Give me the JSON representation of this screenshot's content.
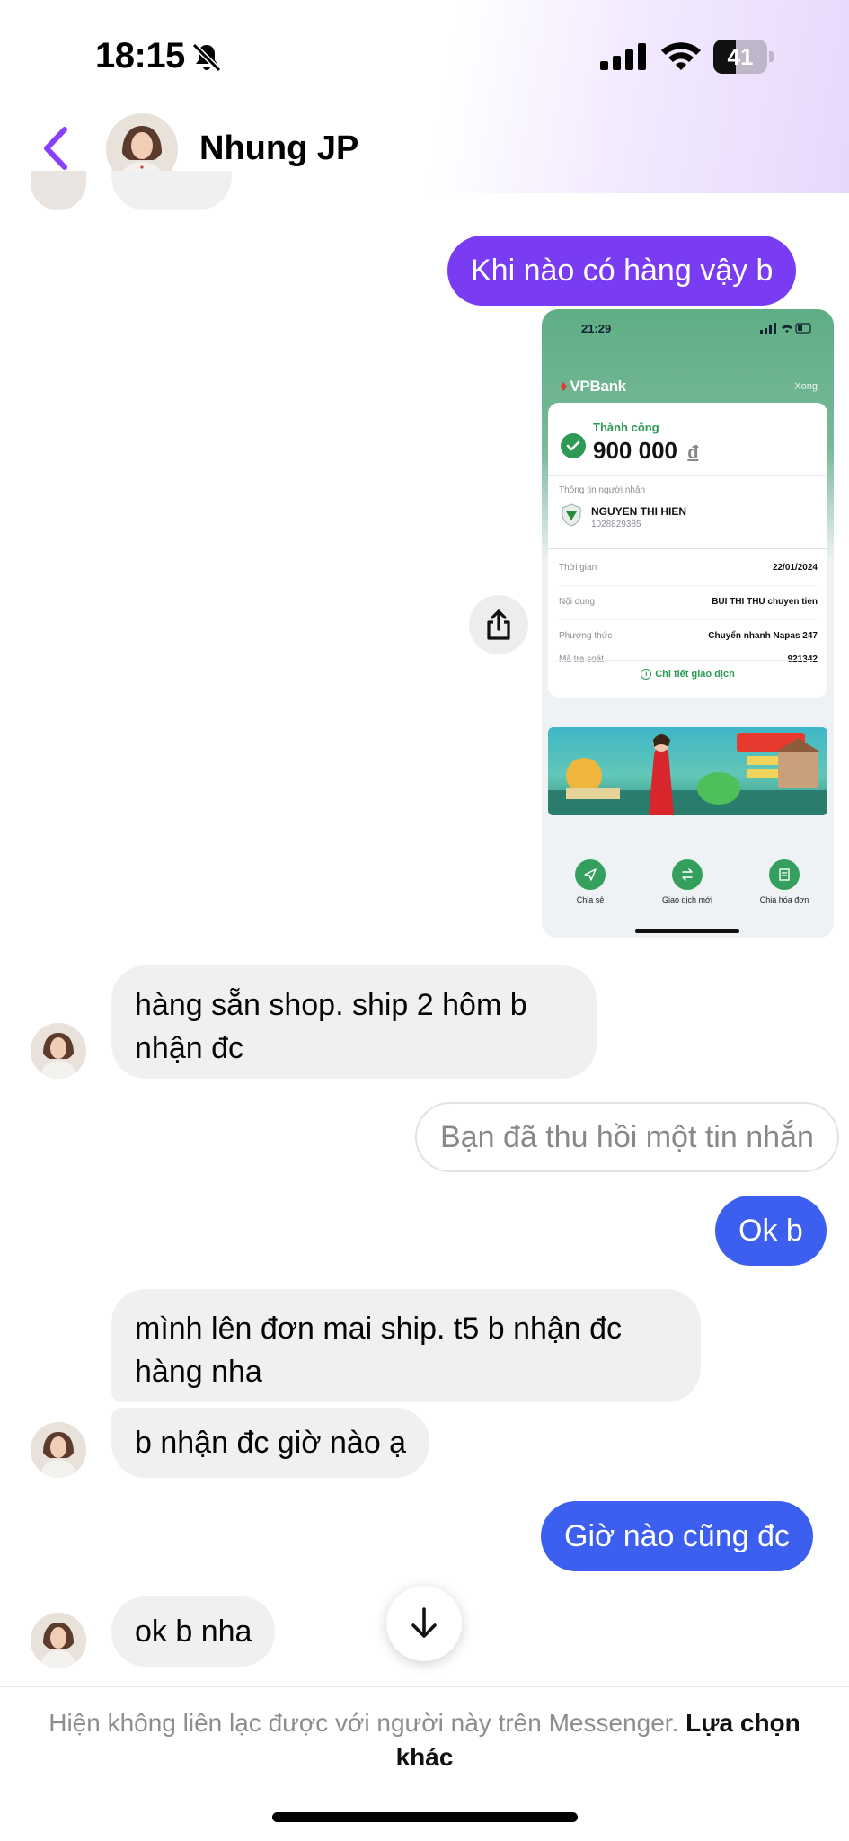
{
  "status_bar": {
    "time": "18:15",
    "battery": "41"
  },
  "header": {
    "contact_name": "Nhung JP"
  },
  "messages": {
    "m1": "Khi nào có hàng  vậy b",
    "m2": "hàng sẵn shop. ship 2 hôm b nhận đc",
    "m3": "Bạn đã thu hồi một tin nhắn",
    "m4": "Ok b",
    "m5": "mình lên đơn mai ship. t5 b nhận đc hàng nha",
    "m6": "b nhận đc giờ nào ạ",
    "m7": "Giờ nào cũng đc",
    "m8": "ok b nha"
  },
  "receipt": {
    "time": "21:29",
    "bank": "VPBank",
    "done": "Xong",
    "status": "Thành công",
    "amount": "900 000",
    "currency": "đ",
    "recipient_label": "Thông tin người nhận",
    "recipient_name": "NGUYEN THI HIEN",
    "recipient_account": "1028829385",
    "rows": [
      {
        "key": "Thời gian",
        "value": "22/01/2024"
      },
      {
        "key": "Nội dung",
        "value": "BUI THI THU chuyen tien"
      },
      {
        "key": "Phương thức",
        "value": "Chuyển nhanh Napas 247"
      },
      {
        "key": "Mã tra soát",
        "value": "921342"
      }
    ],
    "detail_link": "Chi tiết giao dịch",
    "actions": [
      "Chia sẻ",
      "Giao dịch mới",
      "Chia hóa đơn"
    ]
  },
  "footer": {
    "notice": "Hiện không liên lạc được với người này trên Messenger.",
    "link": "Lựa chọn khác"
  },
  "colors": {
    "outgoing_purple": "#7a3cf2",
    "outgoing_blue": "#3c5ff0",
    "incoming_gray": "#f0f0f0",
    "accent_purple": "#8a3ffc"
  }
}
